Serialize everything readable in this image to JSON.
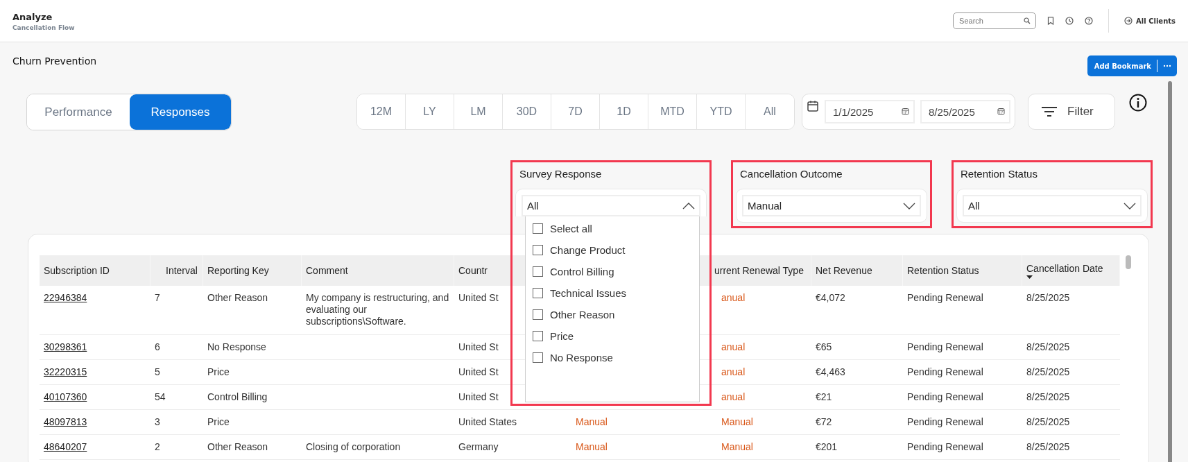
{
  "header": {
    "title": "Analyze",
    "subtitle": "Cancellation Flow",
    "search": {
      "placeholder": "Search"
    },
    "client": "All Clients"
  },
  "page": {
    "title": "Churn Prevention",
    "bookmark_button": "Add Bookmark"
  },
  "view_tabs": [
    {
      "label": "Performance",
      "selected": false
    },
    {
      "label": "Responses",
      "selected": true
    }
  ],
  "periods": [
    {
      "label": "12M",
      "selected": false
    },
    {
      "label": "LY",
      "selected": false
    },
    {
      "label": "LM",
      "selected": false
    },
    {
      "label": "30D",
      "selected": false
    },
    {
      "label": "7D",
      "selected": false
    },
    {
      "label": "1D",
      "selected": false
    },
    {
      "label": "MTD",
      "selected": false
    },
    {
      "label": "YTD",
      "selected": false
    },
    {
      "label": "All",
      "selected": false
    }
  ],
  "dates": {
    "from": "1/1/2025",
    "to": "8/25/2025"
  },
  "filter_button": "Filter",
  "filters": [
    {
      "label": "Survey Response",
      "value": "All",
      "expanded": true,
      "highlighted": true,
      "options": [
        {
          "label": "Select all",
          "checked": false
        },
        {
          "label": "Change Product",
          "checked": false
        },
        {
          "label": "Control Billing",
          "checked": false
        },
        {
          "label": "Technical Issues",
          "checked": false
        },
        {
          "label": "Other Reason",
          "checked": false
        },
        {
          "label": "Price",
          "checked": false
        },
        {
          "label": "No Response",
          "checked": false
        }
      ]
    },
    {
      "label": "Cancellation Outcome",
      "value": "Manual",
      "expanded": false,
      "highlighted": true
    },
    {
      "label": "Retention Status",
      "value": "All",
      "expanded": false,
      "highlighted": true
    }
  ],
  "table": {
    "columns": [
      {
        "label": "Subscription ID",
        "kind": "link"
      },
      {
        "label": "Interval",
        "kind": "text"
      },
      {
        "label": "Reporting Key",
        "kind": "text"
      },
      {
        "label": "Comment",
        "kind": "text"
      },
      {
        "label": "Countr",
        "kind": "text"
      },
      {
        "kind": "outcome"
      },
      {
        "label": "urrent Renewal Type",
        "kind": "outcome"
      },
      {
        "label": "Net Revenue",
        "kind": "text"
      },
      {
        "label": "Retention Status",
        "kind": "text"
      },
      {
        "label": "Cancellation Date",
        "kind": "text",
        "sort_descending": true
      }
    ],
    "rows": [
      [
        "22946384",
        "7",
        "Other Reason",
        "My company is restructuring, and evaluating our subscriptions\\Software.",
        "United St",
        null,
        "anual",
        "€4,072",
        "Pending Renewal",
        "8/25/2025"
      ],
      [
        "30298361",
        "6",
        "No Response",
        null,
        "United St",
        null,
        "anual",
        "€65",
        "Pending Renewal",
        "8/25/2025"
      ],
      [
        "32220315",
        "5",
        "Price",
        null,
        "United St",
        null,
        "anual",
        "€4,463",
        "Pending Renewal",
        "8/25/2025"
      ],
      [
        "40107360",
        "54",
        "Control Billing",
        null,
        "United St",
        null,
        "anual",
        "€21",
        "Pending Renewal",
        "8/25/2025"
      ],
      [
        "48097813",
        "3",
        "Price",
        null,
        "United States",
        "Manual",
        "Manual",
        "€72",
        "Pending Renewal",
        "8/25/2025"
      ],
      [
        "48640207",
        "2",
        "Other Reason",
        "Closing of corporation",
        "Germany",
        "Manual",
        "Manual",
        "€201",
        "Pending Renewal",
        "8/25/2025"
      ]
    ]
  }
}
